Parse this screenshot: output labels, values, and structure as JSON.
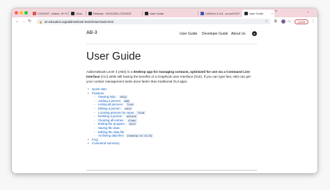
{
  "browser": {
    "tabs": [
      {
        "title": "CS2103T - Admin: IP, Practical Exam",
        "favicon_color": "#d9534f",
        "active": false
      },
      {
        "title": "Ohal...",
        "favicon_color": "#24292e",
        "active": false
      },
      {
        "title": "Release · AY2223S1-CS2103T",
        "favicon_color": "#24292e",
        "active": false
      },
      {
        "title": "User Guide",
        "favicon_color": "#24292e",
        "active": false
      },
      {
        "title": "CATcher 3.4.6 - cs-cs2103T",
        "favicon_color": "#3f51b5",
        "active": false
      },
      {
        "title": "User Guide",
        "favicon_color": "#24292e",
        "active": true
      }
    ],
    "url": "se-education.org/addressbook-level3/UserGuide.html",
    "update_label": "Update"
  },
  "site": {
    "brand": "AB-3",
    "nav": [
      "User Guide",
      "Developer Guide",
      "About Us"
    ]
  },
  "page": {
    "title": "User Guide",
    "intro": {
      "p1": "AddressBook Level 3 (AB3) is a ",
      "p1_bold": "desktop app for managing contacts, optimized for use via a Command Line Interface",
      "p1_rest": " (CLI) while still having the benefits of a Graphical User Interface (GUI). If you can type fast, AB3 can get your contact management tasks done faster than traditional GUI apps."
    },
    "toc": {
      "quick_start": "Quick start",
      "features": "Features",
      "items": [
        {
          "label": "Viewing help : ",
          "code": "help"
        },
        {
          "label": "Adding a person: ",
          "code": "add"
        },
        {
          "label": "Listing all persons : ",
          "code": "list"
        },
        {
          "label": "Editing a person : ",
          "code": "edit"
        },
        {
          "label": "Locating persons by name: ",
          "code": "find"
        },
        {
          "label": "Deleting a person : ",
          "code": "delete"
        },
        {
          "label": "Clearing all entries : ",
          "code": "clear"
        },
        {
          "label": "Exiting the program : ",
          "code": "exit"
        },
        {
          "label": "Saving the data",
          "code": ""
        },
        {
          "label": "Editing the data file",
          "code": ""
        },
        {
          "label": "Archiving data files ",
          "code": "[coming in v2.0]"
        }
      ],
      "faq": "FAQ",
      "command_summary": "Command summary"
    }
  },
  "colors": {
    "tabstrip": "#f3d7dc",
    "link": "#0c5ec2",
    "update_border": "#c85a5a"
  },
  "icons": [
    "back-arrow-icon",
    "forward-arrow-icon",
    "reload-icon",
    "lock-icon",
    "bookmark-star-icon",
    "github-icon"
  ]
}
